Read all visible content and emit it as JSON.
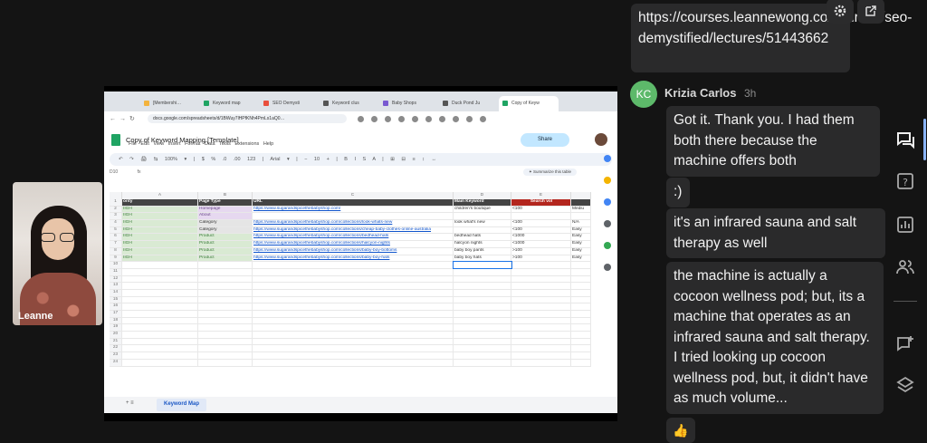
{
  "participant": {
    "name": "Leanne"
  },
  "shared_screen": {
    "browser_tabs": [
      "[Membershi…",
      "Keyword map",
      "SEO Demysti",
      "Keyword clus",
      "Baby Shops",
      "Duck Pond Ju",
      "Copy of Keyw"
    ],
    "url": "docs.google.com/spreadsheets/d/1BWuy7lHPfKNh4PmLs1aQ0…",
    "doc_title": "Copy of Keyword Mapping [Template]",
    "menu": "File  Edit  View  Insert  Format  Data  Tools  Extensions  Help",
    "share_label": "Share",
    "toolbar_text": "↶ ↷ 🖨 ⇆ 100% ▾ | $ % .0 .00 123 | Arial ▾ | − 10 + | B I S A | ⊞ ⊟ ≡ ↕ ↔",
    "cell_ref": "D10",
    "fx": "fx",
    "summarize_label": "✦ Summarize this table",
    "column_letters": [
      "A",
      "B",
      "C",
      "D",
      "E"
    ],
    "headers": {
      "a": "ority",
      "b": "Page Type",
      "c": "URL",
      "d": "Main Keyword",
      "e": "Search vol",
      "f": ""
    },
    "rows": [
      {
        "n": "2",
        "a": "IIGH",
        "b": "Homepage",
        "c": "https://www.sugarandspicethebabyshop.com/",
        "d": "children's boutique",
        "e": "<100",
        "f": "Mediu"
      },
      {
        "n": "3",
        "a": "IIGH",
        "b": "About",
        "c": "",
        "d": "",
        "e": "",
        "f": ""
      },
      {
        "n": "4",
        "a": "IIGH",
        "b": "Category",
        "c": "https://www.sugarandspicethebabyshop.com/collections/look-whats-new",
        "d": "look what's new",
        "e": "<100",
        "f": "N/A"
      },
      {
        "n": "5",
        "a": "IIGH",
        "b": "Category",
        "c": "https://www.sugarandspicethebabyshop.com/collections/cheap-baby-clothes-online-australia",
        "d": "",
        "e": "<100",
        "f": "Easy"
      },
      {
        "n": "6",
        "a": "IIGH",
        "b": "Product",
        "c": "https://www.sugarandspicethebabyshop.com/collections/bedhead-hats",
        "d": "bedhead hats",
        "e": "<1000",
        "f": "Easy"
      },
      {
        "n": "7",
        "a": "IIGH",
        "b": "Product",
        "c": "https://www.sugarandspicethebabyshop.com/collections/halcyon-nights",
        "d": "halcyon nights",
        "e": "<1000",
        "f": "Easy"
      },
      {
        "n": "8",
        "a": "IIGH",
        "b": "Product",
        "c": "https://www.sugarandspicethebabyshop.com/collections/baby-boy-bottoms",
        "d": "baby boy pants",
        "e": ">100",
        "f": "Easy"
      },
      {
        "n": "9",
        "a": "IIGH",
        "b": "Product",
        "c": "https://www.sugarandspicethebabyshop.com/collections/baby-boy-hats",
        "d": "baby boy hats",
        "e": ">100",
        "f": "Easy"
      }
    ],
    "empty_row_numbers": [
      "10",
      "11",
      "12",
      "13",
      "14",
      "15",
      "16",
      "17",
      "18",
      "19",
      "20",
      "21",
      "22",
      "23",
      "24"
    ],
    "sheet_tab": "Keyword Map",
    "sheet_controls": "+   ≡"
  },
  "chat": {
    "link_message": "https://courses.leannewong.co/courses/seo-demystified/lectures/51443662",
    "author": {
      "initials": "KC",
      "name": "Krizia Carlos",
      "time": "3h"
    },
    "messages": [
      "Got it. Thank you. I had them both there because the machine offers both",
      ":)",
      "it's an infrared sauna and salt therapy as well",
      "the machine is actually a cocoon wellness pod; but, its a machine that operates as an infrared sauna and salt therapy. I tried looking up cocoon wellness pod, but, it didn't have as much volume..."
    ],
    "reaction": "👍"
  },
  "colors": {
    "accent": "#8ab4f8",
    "avatar_bg": "#5db96a",
    "bubble": "#2a2a2b",
    "background": "#141414"
  }
}
